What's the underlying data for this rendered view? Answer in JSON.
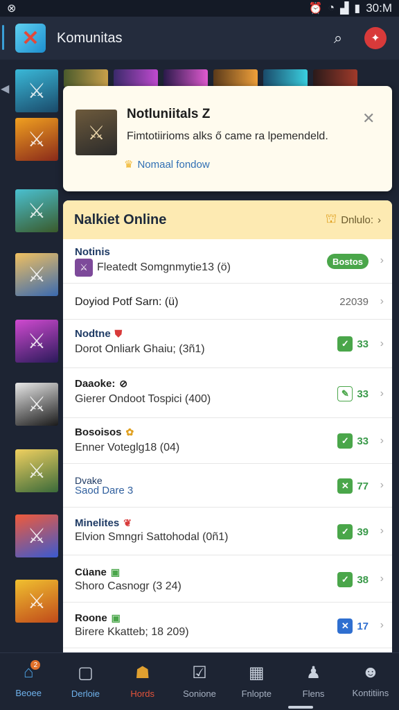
{
  "status_bar": {
    "left_icon": "app-notification-icon",
    "time": "30:M",
    "icons": [
      "alarm-icon",
      "wifi-icon",
      "signal-icon",
      "battery-icon"
    ]
  },
  "app_bar": {
    "title": "Komunitas",
    "logo_icon": "crossed-swords-icon",
    "search_icon": "search-icon",
    "notification_icon": "notification-icon"
  },
  "notice": {
    "title": "Notluniitals",
    "title_suffix": "Z",
    "body": "Fimtotiirioms alks ő came ra lpemendeld.",
    "link": "Nomaal fondow",
    "close_icon": "close-icon"
  },
  "panel": {
    "title": "Nalkiet Online",
    "action_label": "Dnlulo:",
    "rows": [
      {
        "title": "Notinis",
        "text": "Fleatedt Somgnmytie13 (ö)",
        "badge": "Bostos"
      },
      {
        "text": "Doyiod Potf Sarn: (ü)",
        "count": "22039"
      },
      {
        "title": "Nodtne",
        "text": "Dorot Onliark Ghaiu; (3ñ1)",
        "count": "33"
      },
      {
        "title": "Daaoke:",
        "text": "Gierer Ondoot Tospici (400)",
        "count": "33"
      },
      {
        "title": "Bosoisos",
        "text": "Enner Voteglg18 (04)",
        "count": "33"
      },
      {
        "title": "Dvake",
        "text": "Saod Dare 3",
        "count": "77"
      },
      {
        "title": "Minelites",
        "text": "Elvion Smngri Sattohodal (0ñ1)",
        "count": "39"
      },
      {
        "title": "Cüane",
        "text": "Shoro Casnogr (3 24)",
        "count": "38"
      },
      {
        "title": "Roone",
        "text": "Birere Kkatteb; 18 209)",
        "count": "17"
      }
    ]
  },
  "bottom_nav": [
    {
      "label": "Beoee",
      "icon": "home-icon",
      "badge": "2"
    },
    {
      "label": "Derloie",
      "icon": "document-icon"
    },
    {
      "label": "Hords",
      "icon": "game-character-icon"
    },
    {
      "label": "Sonione",
      "icon": "checkbox-icon"
    },
    {
      "label": "Fnlopte",
      "icon": "calendar-icon"
    },
    {
      "label": "Flens",
      "icon": "person-icon"
    },
    {
      "label": "Kontitiins",
      "icon": "community-icon"
    }
  ],
  "colors": {
    "accent_blue": "#4a9ad8",
    "active_red": "#e4533a",
    "success_green": "#4aa64a",
    "header_yellow": "#fdeab2"
  }
}
